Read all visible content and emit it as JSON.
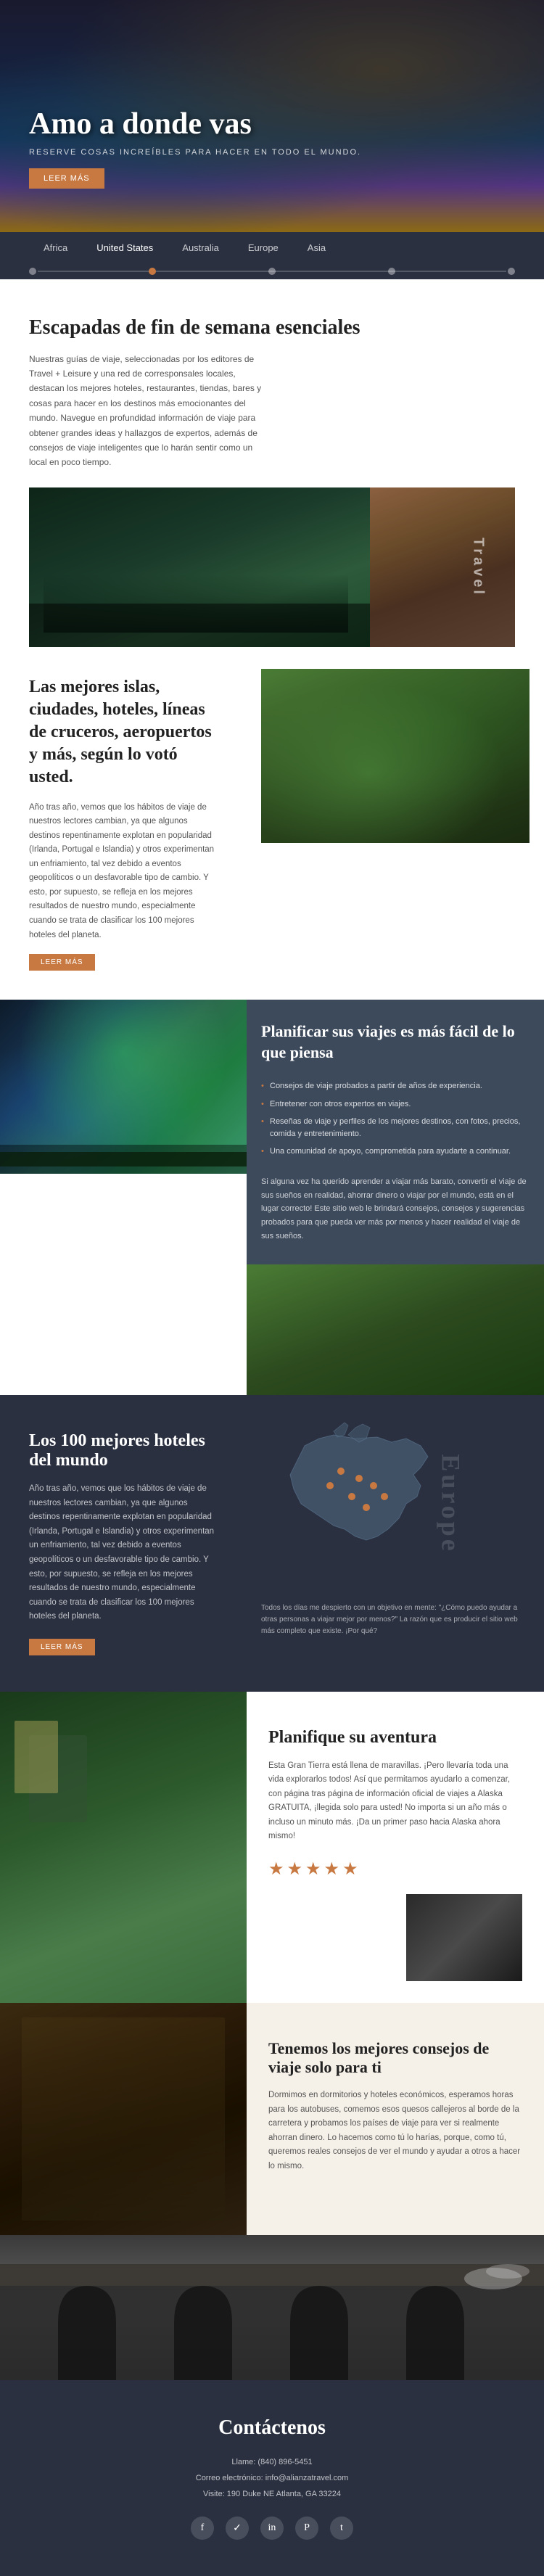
{
  "hero": {
    "title": "Amo a donde vas",
    "subtitle": "RESERVE COSAS INCREÍBLES PARA HACER EN TODO EL MUNDO.",
    "btn_label": "LEER MÁS"
  },
  "nav": {
    "tabs": [
      "Africa",
      "United States",
      "Australia",
      "Europe",
      "Asia"
    ],
    "active": 1
  },
  "weekend": {
    "title": "Escapadas de fin de semana esenciales",
    "text": "Nuestras guías de viaje, seleccionadas por los editores de Travel + Leisure y una red de corresponsales locales, destacan los mejores hoteles, restaurantes, tiendas, bares y cosas para hacer en los destinos más emocionantes del mundo. Navegue en profundidad información de viaje para obtener grandes ideas y hallazgos de expertos, además de consejos de viaje inteligentes que lo harán sentir como un local en poco tiempo."
  },
  "islands": {
    "title": "Las mejores islas, ciudades, hoteles, líneas de cruceros, aeropuertos y más, según lo votó usted.",
    "text": "Año tras año, vemos que los hábitos de viaje de nuestros lectores cambian, ya que algunos destinos repentinamente explotan en popularidad (Irlanda, Portugal e Islandia) y otros experimentan un enfriamiento, tal vez debido a eventos geopolíticos o un desfavorable tipo de cambio. Y esto, por supuesto, se refleja en los mejores resultados de nuestro mundo, especialmente cuando se trata de clasificar los 100 mejores hoteles del planeta.",
    "btn_label": "LEER MÁS",
    "travel_label": "Travel"
  },
  "plan": {
    "title": "Planificar sus viajes es más fácil de lo que piensa",
    "list": [
      "Consejos de viaje probados a partir de años de experiencia.",
      "Entretener con otros expertos en viajes.",
      "Reseñas de viaje y perfiles de los mejores destinos, con fotos, precios, comida y entretenimiento.",
      "Una comunidad de apoyo, comprometida para ayudarte a continuar."
    ],
    "text": "Si alguna vez ha querido aprender a viajar más barato, convertir el viaje de sus sueños en realidad, ahorrar dinero o viajar por el mundo, está en el lugar correcto! Este sitio web le brindará consejos, consejos y sugerencias probados para que pueda ver más por menos y hacer realidad el viaje de sus sueños."
  },
  "hotels": {
    "title": "Los 100 mejores hoteles del mundo",
    "text": "Año tras año, vemos que los hábitos de viaje de nuestros lectores cambian, ya que algunos destinos repentinamente explotan en popularidad (Irlanda, Portugal e Islandia) y otros experimentan un enfriamiento, tal vez debido a eventos geopolíticos o un desfavorable tipo de cambio. Y esto, por supuesto, se refleja en los mejores resultados de nuestro mundo, especialmente cuando se trata de clasificar los 100 mejores hoteles del planeta.",
    "btn_label": "LEER MÁS",
    "europe_label": "Europe",
    "quote": "Todos los días me despierto con un objetivo en mente: \"¿Cómo puedo ayudar a otras personas a viajar mejor por menos?\" La razón que es producir el sitio web más completo que existe. ¡Por qué?"
  },
  "adventure": {
    "title": "Planifique su aventura",
    "text": "Esta Gran Tierra está llena de maravillas. ¡Pero llevaría toda una vida explorarlos todos! Así que permitamos ayudarlo a comenzar, con página tras página de información oficial de viajes a Alaska GRATUITA, ¡llegida solo para usted! No importa si un año más o incluso un minuto más. ¡Da un primer paso hacia Alaska ahora mismo!",
    "stars": "★★★★★"
  },
  "tips": {
    "title": "Tenemos los mejores consejos de viaje solo para ti",
    "text": "Dormimos en dormitorios y hoteles económicos, esperamos horas para los autobuses, comemos esos quesos callejeros al borde de la carretera y probamos los países de viaje para ver si realmente ahorran dinero. Lo hacemos como tú lo harías, porque, como tú, queremos reales consejos de ver el mundo y ayudar a otros a hacer lo mismo."
  },
  "contact": {
    "title": "Contáctenos",
    "phone": "Llame: (840) 896-5451",
    "email": "Correo electrónico: info@alianzatravel.com",
    "address": "Visite: 190 Duke NE Atlanta, GA 33224",
    "social": [
      "f",
      "✓",
      "in",
      "P",
      "t"
    ]
  }
}
